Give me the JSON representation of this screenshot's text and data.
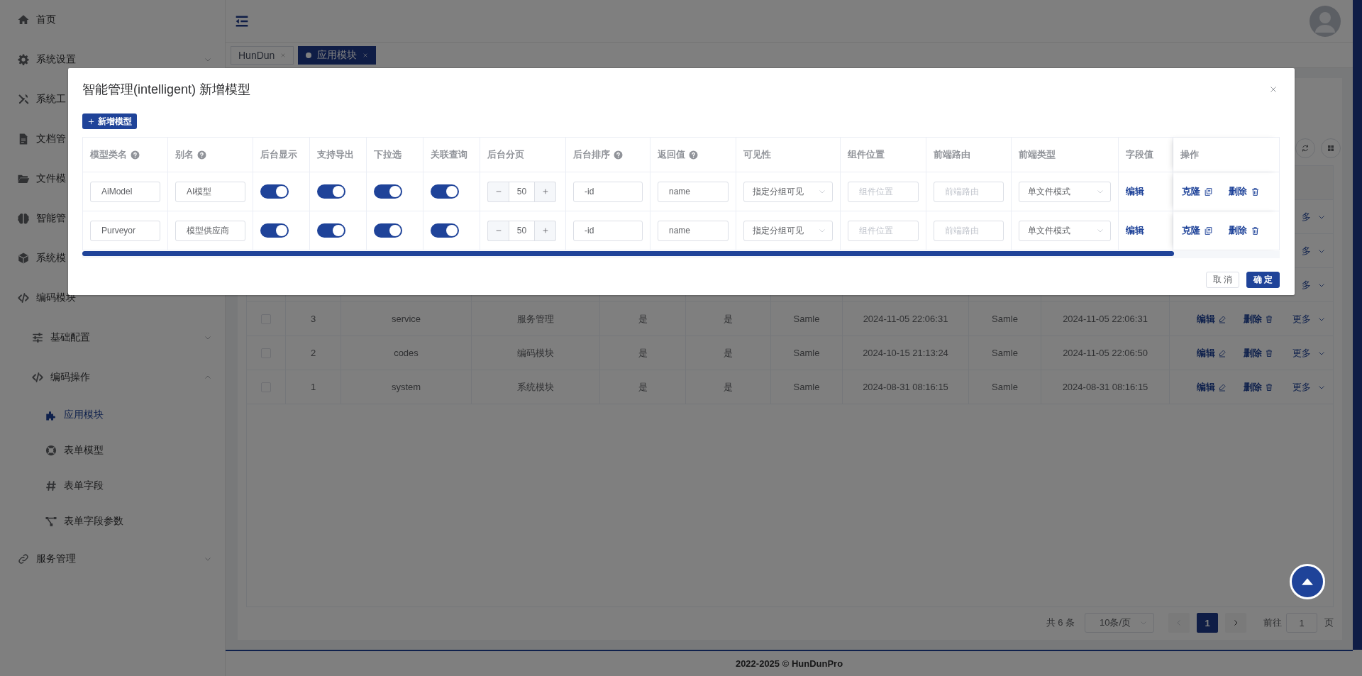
{
  "sidebar": {
    "items": [
      {
        "label": "首页",
        "selected": false
      },
      {
        "label": "系统设置",
        "selected": false,
        "expanded": false
      },
      {
        "label": "系统工",
        "selected": false
      },
      {
        "label": "文档管",
        "selected": false
      },
      {
        "label": "文件模",
        "selected": false
      },
      {
        "label": "智能管",
        "selected": false
      },
      {
        "label": "系统模",
        "selected": false
      },
      {
        "label": "编码模块",
        "selected": false,
        "children": [
          {
            "label": "基础配置",
            "selected": false,
            "expanded": false
          },
          {
            "label": "编码操作",
            "selected": false,
            "expanded": true,
            "children": [
              {
                "label": "应用模块",
                "selected": true
              },
              {
                "label": "表单模型",
                "selected": false
              },
              {
                "label": "表单字段",
                "selected": false
              },
              {
                "label": "表单字段参数",
                "selected": false
              }
            ]
          }
        ]
      },
      {
        "label": "服务管理",
        "selected": false,
        "expanded": false
      }
    ]
  },
  "header": {
    "tabs": [
      {
        "label": "HunDun",
        "selected": false
      },
      {
        "label": "应用模块",
        "selected": true
      }
    ]
  },
  "table": {
    "rows": [
      {
        "actions": {
          "more": "多"
        }
      },
      {
        "actions": {
          "more": "多"
        }
      },
      {
        "actions": {
          "more": "多"
        }
      },
      {
        "checked": false,
        "cells": [
          "3",
          "service",
          "服务管理",
          "是",
          "是",
          "Samle",
          "2024-11-05 22:06:31",
          "Samle",
          "2024-11-05 22:06:31"
        ],
        "actions": {
          "edit": "编辑",
          "delete": "删除",
          "more": "更多"
        }
      },
      {
        "checked": false,
        "cells": [
          "2",
          "codes",
          "编码模块",
          "是",
          "是",
          "Samle",
          "2024-10-15 21:13:24",
          "Samle",
          "2024-11-05 22:06:50"
        ],
        "actions": {
          "edit": "编辑",
          "delete": "删除",
          "more": "更多"
        }
      },
      {
        "checked": false,
        "cells": [
          "1",
          "system",
          "系统模块",
          "是",
          "是",
          "Samle",
          "2024-08-31 08:16:15",
          "Samle",
          "2024-08-31 08:16:15"
        ],
        "actions": {
          "edit": "编辑",
          "delete": "删除",
          "more": "更多"
        }
      }
    ]
  },
  "pagination": {
    "total": "共 6 条",
    "page_size": "10条/页",
    "prev_disabled": true,
    "next_disabled": false,
    "pages": [
      {
        "label": "1",
        "selected": true
      }
    ],
    "goto_label": "前往",
    "goto_value": "1",
    "page_suffix": "页"
  },
  "footer": {
    "text": "2022-2025 © HunDunPro"
  },
  "dialog": {
    "title": "智能管理(intelligent) 新增模型",
    "add_button": "新增模型",
    "columns": [
      {
        "label": "模型类名",
        "help": true
      },
      {
        "label": "别名",
        "help": true
      },
      {
        "label": "后台显示",
        "help": false
      },
      {
        "label": "支持导出",
        "help": false
      },
      {
        "label": "下拉选",
        "help": false
      },
      {
        "label": "关联查询",
        "help": false
      },
      {
        "label": "后台分页",
        "help": false
      },
      {
        "label": "后台排序",
        "help": true
      },
      {
        "label": "返回值",
        "help": true
      },
      {
        "label": "可见性",
        "help": false
      },
      {
        "label": "组件位置",
        "help": false
      },
      {
        "label": "前端路由",
        "help": false
      },
      {
        "label": "前端类型",
        "help": false
      },
      {
        "label": "字段值",
        "help": false
      },
      {
        "label": "操作",
        "help": false
      }
    ],
    "rows": [
      {
        "cells": [
          {
            "kind": "input",
            "value": "AiModel"
          },
          {
            "kind": "input",
            "value": "AI模型"
          },
          {
            "kind": "switch",
            "on": true
          },
          {
            "kind": "switch",
            "on": true
          },
          {
            "kind": "switch",
            "on": true
          },
          {
            "kind": "switch",
            "on": true
          },
          {
            "kind": "stepper",
            "value": "50"
          },
          {
            "kind": "input",
            "value": "-id"
          },
          {
            "kind": "input",
            "value": "name"
          },
          {
            "kind": "select",
            "value": "指定分组可见"
          },
          {
            "kind": "input",
            "placeholder": "组件位置"
          },
          {
            "kind": "input",
            "placeholder": "前端路由"
          },
          {
            "kind": "select",
            "value": "单文件模式"
          },
          {
            "kind": "link",
            "text": "编辑"
          },
          {
            "kind": "actions",
            "clone": "克隆",
            "delete": "删除"
          }
        ]
      },
      {
        "cells": [
          {
            "kind": "input",
            "value": "Purveyor"
          },
          {
            "kind": "input",
            "value": "模型供应商"
          },
          {
            "kind": "switch",
            "on": true
          },
          {
            "kind": "switch",
            "on": true
          },
          {
            "kind": "switch",
            "on": true
          },
          {
            "kind": "switch",
            "on": true
          },
          {
            "kind": "stepper",
            "value": "50"
          },
          {
            "kind": "input",
            "value": "-id"
          },
          {
            "kind": "input",
            "value": "name"
          },
          {
            "kind": "select",
            "value": "指定分组可见"
          },
          {
            "kind": "input",
            "placeholder": "组件位置"
          },
          {
            "kind": "input",
            "placeholder": "前端路由"
          },
          {
            "kind": "select",
            "value": "单文件模式"
          },
          {
            "kind": "link",
            "text": "编辑"
          },
          {
            "kind": "actions",
            "clone": "克隆",
            "delete": "删除"
          }
        ]
      }
    ],
    "cancel": "取消",
    "confirm": "确定"
  }
}
